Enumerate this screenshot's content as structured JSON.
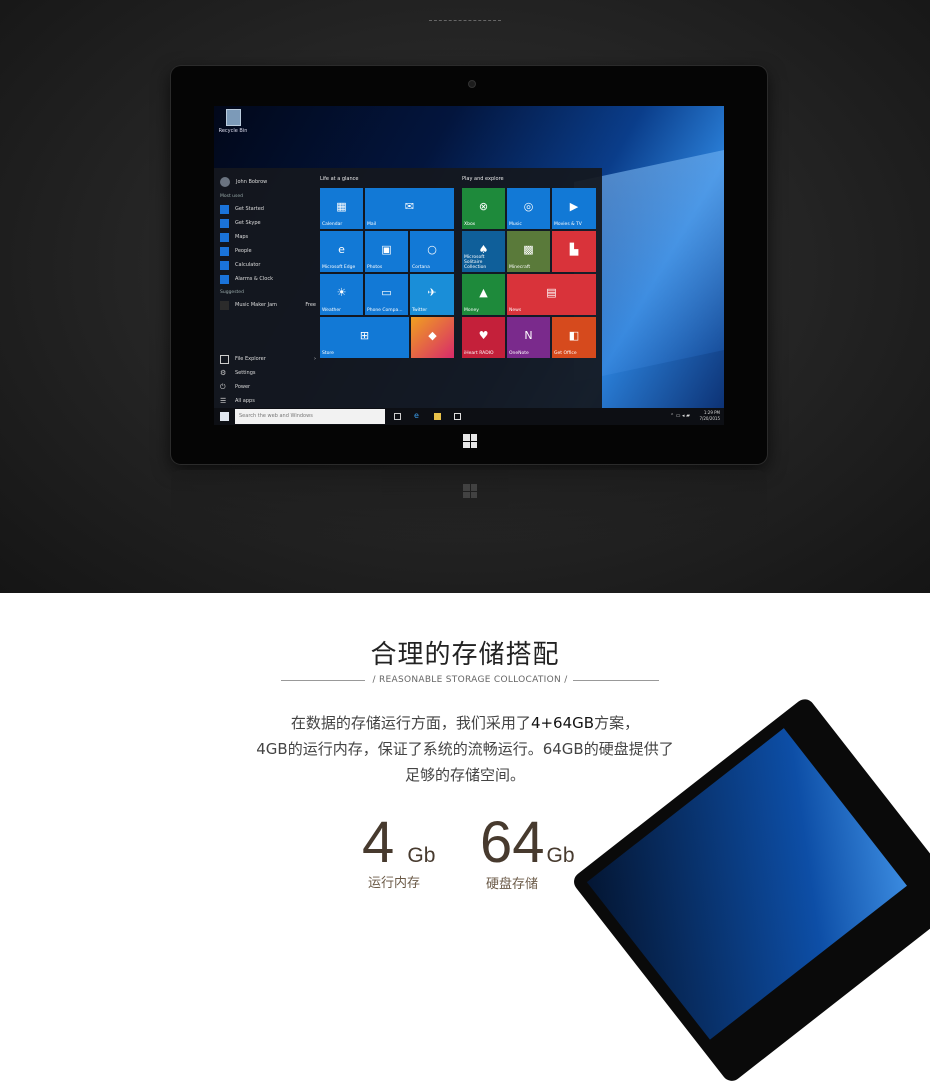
{
  "hero": {
    "screen": {
      "desktop_icon": "Recycle Bin",
      "start_menu": {
        "user": "John Bobrow",
        "most_used_label": "Most used",
        "most_used": [
          "Get Started",
          "Get Skype",
          "Maps",
          "People",
          "Calculator",
          "Alarms & Clock"
        ],
        "suggested_label": "Suggested",
        "suggested_app": "Music Maker Jam",
        "suggested_price": "Free",
        "bottom_items": [
          "File Explorer",
          "Settings",
          "Power",
          "All apps"
        ],
        "group1_label": "Life at a glance",
        "group2_label": "Play and explore",
        "tiles_group1": [
          {
            "label": "Calendar",
            "icon": "calendar-icon"
          },
          {
            "label": "Mail",
            "icon": "mail-icon"
          },
          {
            "label": "Microsoft Edge",
            "icon": "edge-icon"
          },
          {
            "label": "Photos",
            "icon": "photos-icon"
          },
          {
            "label": "Cortana",
            "icon": "cortana-icon"
          },
          {
            "label": "Weather",
            "icon": "weather-icon"
          },
          {
            "label": "Phone Compa...",
            "icon": "phone-icon"
          },
          {
            "label": "Twitter",
            "icon": "twitter-icon"
          },
          {
            "label": "Store",
            "icon": "store-icon"
          },
          {
            "label": "",
            "icon": "candy-icon"
          }
        ],
        "tiles_group2": [
          {
            "label": "Xbox",
            "icon": "xbox-icon"
          },
          {
            "label": "Music",
            "icon": "music-icon"
          },
          {
            "label": "Movies & TV",
            "icon": "movies-icon"
          },
          {
            "label": "Microsoft Solitaire Collection",
            "icon": "cards-icon"
          },
          {
            "label": "Minecraft",
            "icon": "minecraft-icon"
          },
          {
            "label": "",
            "icon": "flipboard-icon"
          },
          {
            "label": "Money",
            "icon": "money-icon"
          },
          {
            "label": "News",
            "icon": "news-icon"
          },
          {
            "label": "iHeart RADIO",
            "icon": "iheart-icon"
          },
          {
            "label": "OneNote",
            "icon": "onenote-icon"
          },
          {
            "label": "Get Office",
            "icon": "office-icon"
          }
        ]
      },
      "taskbar": {
        "search_placeholder": "Search the web and Windows",
        "time": "1:29 PM",
        "date": "7/20/2015"
      }
    }
  },
  "section": {
    "title": "合理的存储搭配",
    "subtitle": "/   REASONABLE STORAGE COLLOCATION   /",
    "para": {
      "line1_a": "在数据的存储运行方面，我们采用了",
      "line1_em": "4+64GB",
      "line1_b": "方案，",
      "line2": "4GB的运行内存，保证了系统的流畅运行。64GB的硬盘提供了",
      "line3": "足够的存储空间。"
    },
    "stats": [
      {
        "num": "4",
        "unit": "Gb",
        "label": "运行内存"
      },
      {
        "num": "64",
        "unit": "Gb",
        "label": "硬盘存储"
      }
    ]
  },
  "colors": {
    "tile_blue": "#1279d6",
    "tile_green": "#1e8a3b",
    "tile_red": "#d9333a",
    "tile_orange": "#d64a1d",
    "tile_purple": "#7a2a8c",
    "stat_brown": "#473a2e"
  }
}
